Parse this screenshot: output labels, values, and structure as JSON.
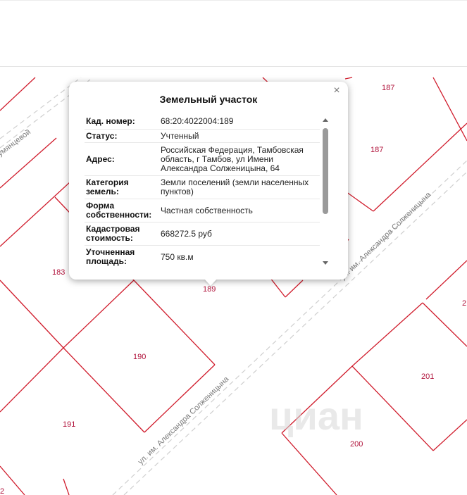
{
  "popup": {
    "title": "Земельный участок",
    "close_icon": "close-icon",
    "rows": [
      {
        "key": "Кад. номер:",
        "value": "68:20:4022004:189"
      },
      {
        "key": "Статус:",
        "value": "Учтенный"
      },
      {
        "key": "Адрес:",
        "value": "Российская Федерация, Тамбовская область, г Тамбов, ул Имени Александра Солженицына, 64"
      },
      {
        "key": "Категория земель:",
        "value": "Земли поселений (земли населенных пунктов)"
      },
      {
        "key": "Форма собственности:",
        "value": "Частная собственность"
      },
      {
        "key": "Кадастровая стоимость:",
        "value": "668272.5 руб"
      },
      {
        "key": "Уточненная площадь:",
        "value": "750 кв.м"
      }
    ]
  },
  "map": {
    "parcel_color": "#d01c2c",
    "street_color": "#c9c9c9",
    "parcel_numbers": [
      "187",
      "187",
      "183",
      "189",
      "190",
      "191",
      "200",
      "201",
      "2",
      "2"
    ],
    "streets": [
      "ул. им. Александра Солженицына",
      "ул. им. Александра Солженицына",
      "ул. им. Александра Солженицына",
      "умянцевой"
    ],
    "watermark": "циан"
  }
}
